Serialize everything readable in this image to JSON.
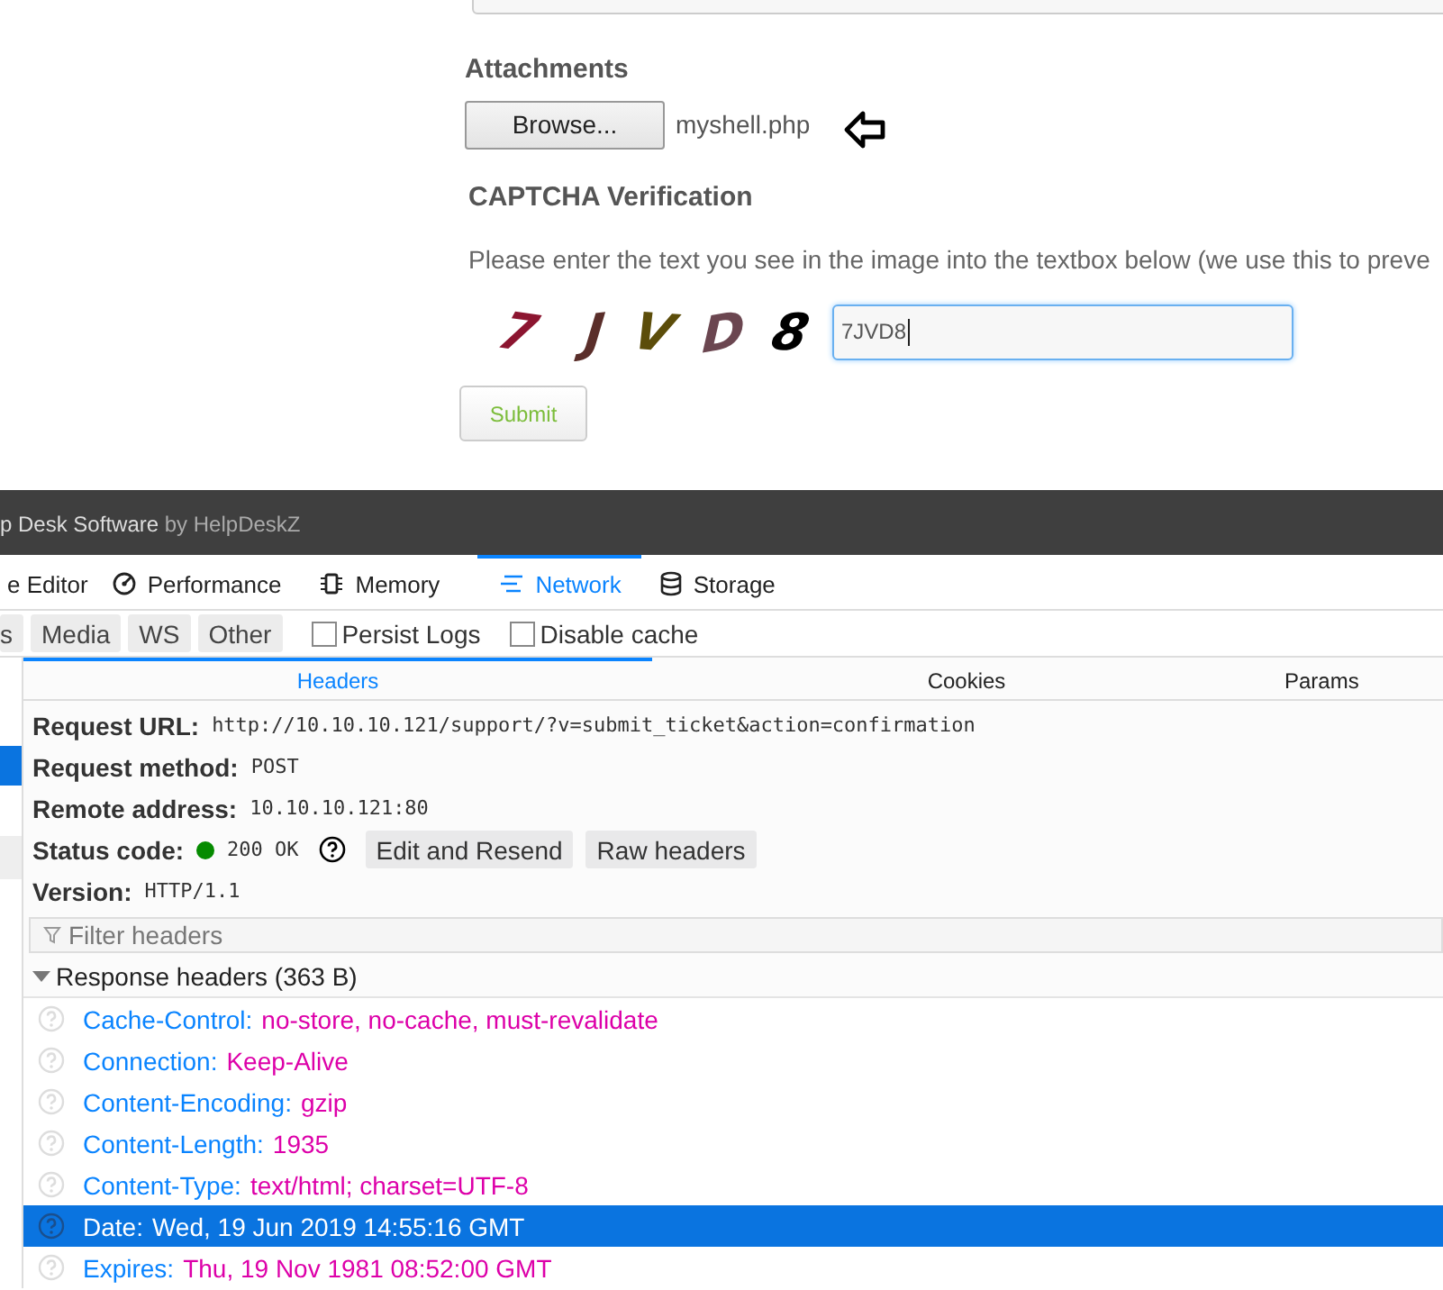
{
  "form": {
    "attachments_label": "Attachments",
    "browse_button": "Browse...",
    "file_name": "myshell.php",
    "captcha_heading": "CAPTCHA Verification",
    "captcha_text": "Please enter the text you see in the image into the textbox below (we use this to preve",
    "captcha_glyphs": [
      {
        "char": "7",
        "color": "#8c1530"
      },
      {
        "char": "J",
        "color": "#5a2e2a"
      },
      {
        "char": "V",
        "color": "#5c4d0a"
      },
      {
        "char": "D",
        "color": "#6b4650"
      },
      {
        "char": "8",
        "color": "#000000"
      }
    ],
    "captcha_value": "7JVD8",
    "submit_button": "Submit"
  },
  "window": {
    "title": "p Desk Software",
    "title_suffix": "by HelpDeskZ"
  },
  "tabs": [
    {
      "label": "e Editor",
      "selected": false
    },
    {
      "label": "Performance",
      "selected": false
    },
    {
      "label": "Memory",
      "selected": false
    },
    {
      "label": "Network",
      "selected": true
    },
    {
      "label": "Storage",
      "selected": false
    }
  ],
  "filters": [
    {
      "label": "s"
    },
    {
      "label": "Media"
    },
    {
      "label": "WS"
    },
    {
      "label": "Other"
    }
  ],
  "options": [
    {
      "label": "Persist Logs",
      "checked": false
    },
    {
      "label": "Disable cache",
      "checked": false
    }
  ],
  "detail_tabs": [
    {
      "label": "Headers",
      "selected": true
    },
    {
      "label": "Cookies",
      "selected": false
    },
    {
      "label": "Params",
      "selected": false
    }
  ],
  "summary": [
    {
      "label": "Request URL:",
      "value": "http://10.10.10.121/support/?v=submit_ticket&action=confirmation"
    },
    {
      "label": "Request method:",
      "value": "POST"
    },
    {
      "label": "Remote address:",
      "value": "10.10.10.121:80"
    }
  ],
  "status": {
    "label": "Status code:",
    "value": "200 OK",
    "color": "#058b00",
    "buttons": [
      "Edit and Resend",
      "Raw headers"
    ]
  },
  "version": {
    "label": "Version:",
    "value": "HTTP/1.1"
  },
  "filter_headers": {
    "placeholder": "Filter headers"
  },
  "response_headers": {
    "title": "Response headers (363 B)",
    "expanded": true,
    "rows": [
      {
        "name": "Cache-Control:",
        "value": "no-store, no-cache, must-revalidate",
        "selected": false
      },
      {
        "name": "Connection:",
        "value": "Keep-Alive",
        "selected": false
      },
      {
        "name": "Content-Encoding:",
        "value": "gzip",
        "selected": false
      },
      {
        "name": "Content-Length:",
        "value": "1935",
        "selected": false
      },
      {
        "name": "Content-Type:",
        "value": "text/html; charset=UTF-8",
        "selected": false
      },
      {
        "name": "Date:",
        "value": "Wed, 19 Jun 2019 14:55:16 GMT",
        "selected": true
      },
      {
        "name": "Expires:",
        "value": "Thu, 19 Nov 1981 08:52:00 GMT",
        "selected": false
      }
    ]
  }
}
